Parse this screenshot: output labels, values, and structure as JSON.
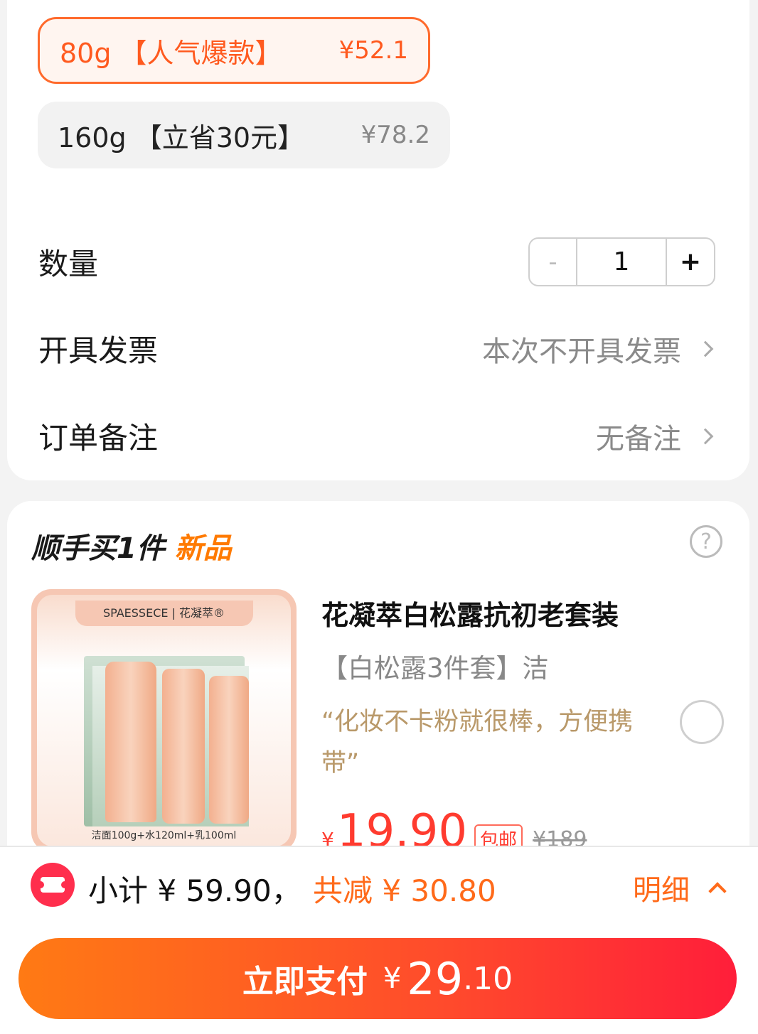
{
  "specs": [
    {
      "label": "80g 【人气爆款】",
      "price": "¥52.1",
      "selected": true
    },
    {
      "label": "160g 【立省30元】",
      "price": "¥78.2",
      "selected": false
    }
  ],
  "quantity": {
    "label": "数量",
    "minus": "-",
    "value": "1",
    "plus": "+"
  },
  "invoice": {
    "label": "开具发票",
    "value": "本次不开具发票"
  },
  "note": {
    "label": "订单备注",
    "value": "无备注"
  },
  "addon": {
    "title_prefix": "顺手买1件",
    "title_highlight": "新品",
    "help_icon": "?",
    "product": {
      "brand": "SPAESSECE | 花凝萃®",
      "image_caption": "洁面100g+水120ml+乳100ml",
      "name": "花凝萃白松露抗初老套装",
      "sku": "【白松露3件套】洁",
      "review": "“化妆不卡粉就很棒，方便携带”",
      "currency": "¥",
      "price": "19.90",
      "shipping_badge": "包邮",
      "original_price": "¥189"
    }
  },
  "summary": {
    "subtotal": "小计 ¥ 59.90，",
    "discount": "共减 ¥ 30.80",
    "detail": "明细"
  },
  "pay": {
    "label": "立即支付",
    "currency": "¥",
    "amount_int": "29",
    "amount_dec": ".10"
  },
  "colors": {
    "accent": "#ff6a1a",
    "price_red": "#ff3b2f",
    "coupon_red": "#ff2e4d"
  }
}
